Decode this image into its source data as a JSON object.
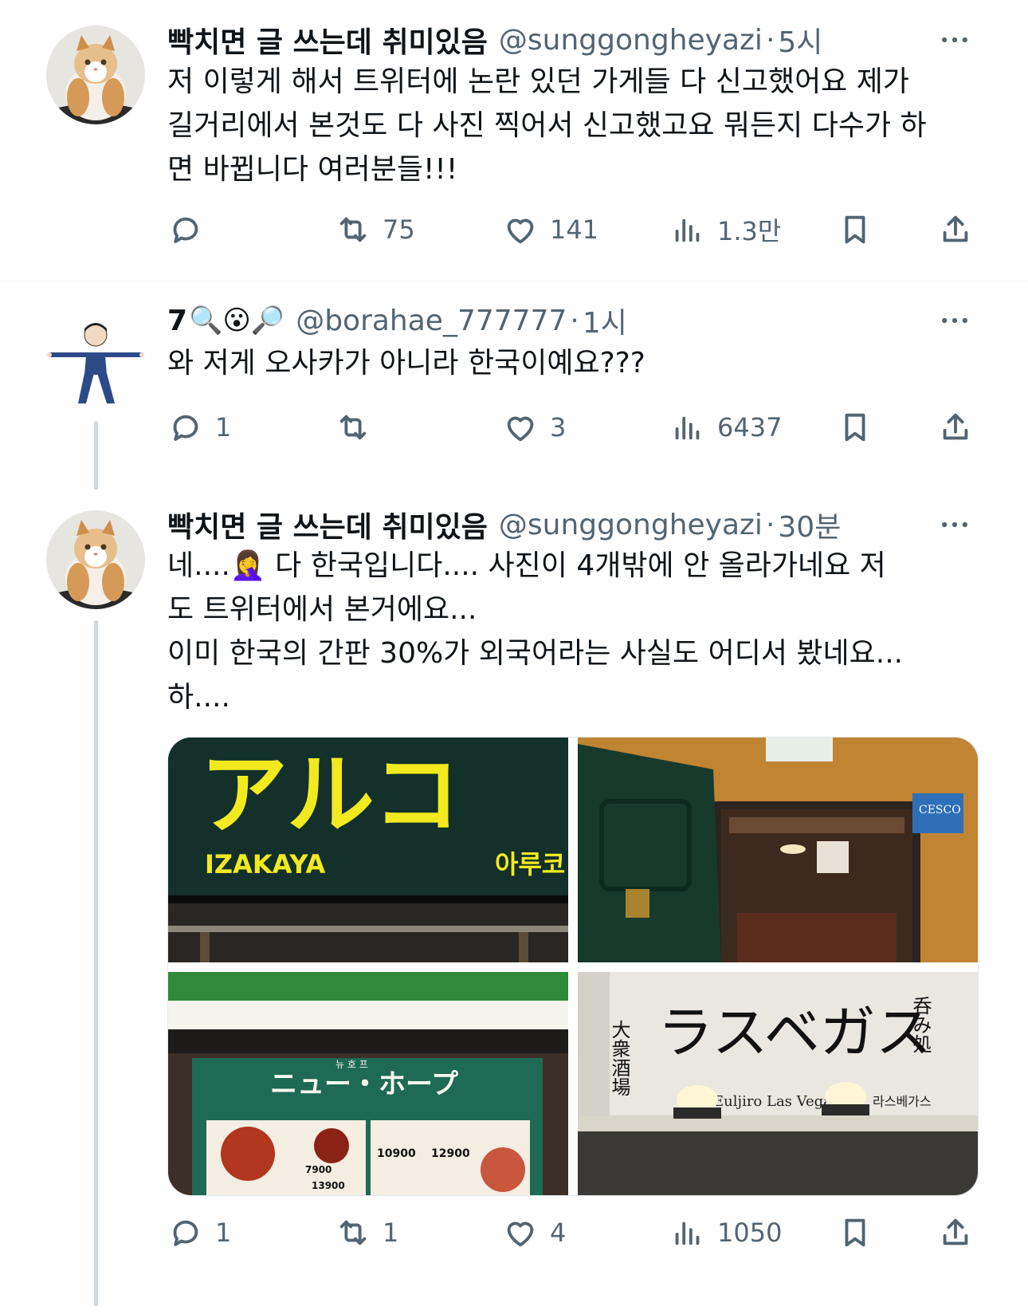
{
  "tweets": [
    {
      "name": "빡치면 글 쓰는데 취미있음",
      "handle": "@sunggongheyazi",
      "time": "5시",
      "text": "저 이렇게 해서 트위터에 논란 있던 가게들 다 신고했어요 제가\n길거리에서 본것도 다 사진 찍어서 신고했고요 뭐든지 다수가 하\n면 바뀝니다 여러분들!!!",
      "replies": "",
      "retweets": "75",
      "likes": "141",
      "views": "1.3만"
    },
    {
      "name": "7",
      "name_emojis": "🔍😮🔎",
      "handle": "@borahae_777777",
      "time": "1시",
      "text": "와 저게 오사카가 아니라 한국이예요???",
      "replies": "1",
      "retweets": "",
      "likes": "3",
      "views": "6437"
    },
    {
      "name": "빡치면 글 쓰는데 취미있음",
      "handle": "@sunggongheyazi",
      "time": "30분",
      "text_line1_a": "네....",
      "text_line1_emoji": "🤦‍♀️",
      "text_line1_b": " 다 한국입니다.... 사진이 4개밖에 안 올라가네요 저",
      "text_rest": "도 트위터에서 본거에요...\n이미 한국의 간판 30%가 외국어라는 사실도 어디서 봤네요...\n하....",
      "replies": "1",
      "retweets": "1",
      "likes": "4",
      "views": "1050",
      "images": {
        "sign1_main": "アルコ",
        "sign1_left": "IZAKAYA",
        "sign1_right": "아루코",
        "door_badge": "CESCO",
        "sign3_title": "ニュー・ホープ",
        "sign3_sub": "뉴 호 프",
        "sign3_price1": "7900",
        "sign3_price2": "10900",
        "sign3_price3": "12900",
        "sign3_price4": "13900",
        "sign4_main": "ラスベガス",
        "sign4_side": "大衆酒場",
        "sign4_right": "呑み処",
        "sign4_en": "Euljiro  Las Vegas",
        "sign4_ko": "라스베가스"
      }
    }
  ],
  "colors": {
    "text": "#0f1419",
    "secondary": "#536471",
    "thread_line": "#cfd9de",
    "divider": "#eff3f4"
  },
  "icons": [
    "reply-icon",
    "retweet-icon",
    "like-icon",
    "views-icon",
    "bookmark-icon",
    "share-icon",
    "more-icon"
  ]
}
